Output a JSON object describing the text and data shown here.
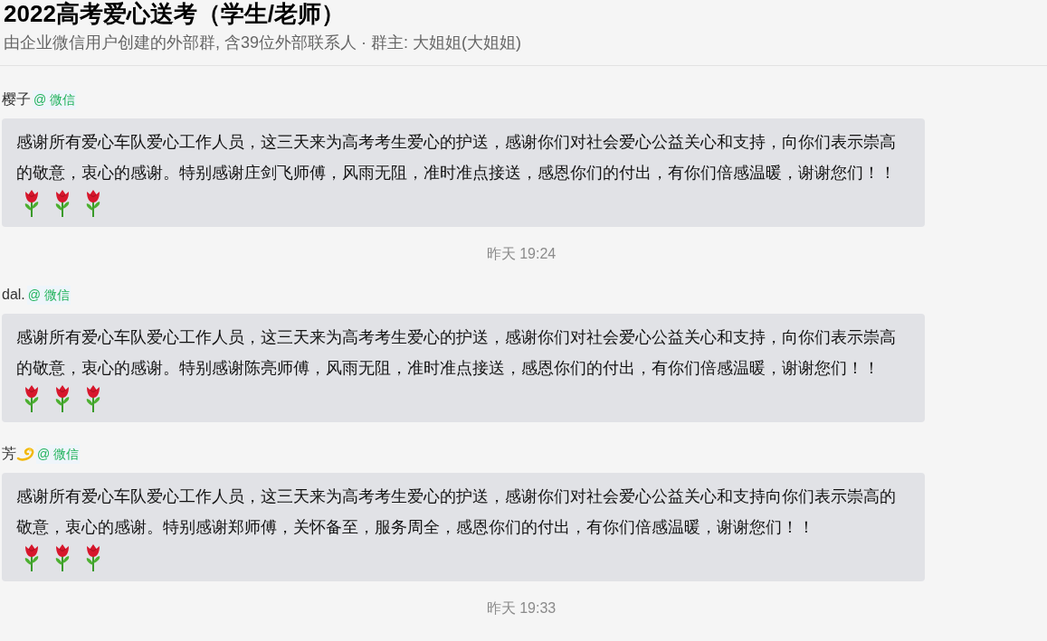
{
  "header": {
    "title": "2022高考爱心送考（学生/老师）",
    "subtitle": "由企业微信用户创建的外部群, 含39位外部联系人 · 群主: 大姐姐(大姐姐)"
  },
  "feed": [
    {
      "kind": "message",
      "sender": "樱子",
      "source": "@ 微信",
      "text": "感谢所有爱心车队爱心工作人员，这三天来为高考考生爱心的护送，感谢你们对社会爱心公益关心和支持，向你们表示崇高的敬意，衷心的感谢。特别感谢庄剑飞师傅，风雨无阻，准时准点接送，感恩你们的付出，有你们倍感温暖，谢谢您们！！",
      "emoji": [
        {
          "kind": "rose"
        },
        {
          "kind": "rose"
        },
        {
          "kind": "rose"
        }
      ]
    },
    {
      "kind": "time",
      "text": "昨天 19:24"
    },
    {
      "kind": "message",
      "sender": "dal.",
      "source": "@ 微信",
      "text": "感谢所有爱心车队爱心工作人员，这三天来为高考考生爱心的护送，感谢你们对社会爱心公益关心和支持，向你们表示崇高的敬意，衷心的感谢。特别感谢陈亮师傅，风雨无阻，准时准点接送，感恩你们的付出，有你们倍感温暖，谢谢您们！！",
      "emoji": [
        {
          "kind": "rose"
        },
        {
          "kind": "rose"
        },
        {
          "kind": "rose"
        }
      ]
    },
    {
      "kind": "message",
      "sender": "芳",
      "sender_emoji": [
        {
          "kind": "dizzy"
        }
      ],
      "source": "@ 微信",
      "text": "感谢所有爱心车队爱心工作人员，这三天来为高考考生爱心的护送，感谢你们对社会爱心公益关心和支持向你们表示崇高的敬意，衷心的感谢。特别感谢郑师傅，关怀备至，服务周全，感恩你们的付出，有你们倍感温暖，谢谢您们！！",
      "emoji": [
        {
          "kind": "rose"
        },
        {
          "kind": "rose"
        },
        {
          "kind": "rose"
        }
      ]
    },
    {
      "kind": "time",
      "text": "昨天 19:33"
    }
  ]
}
